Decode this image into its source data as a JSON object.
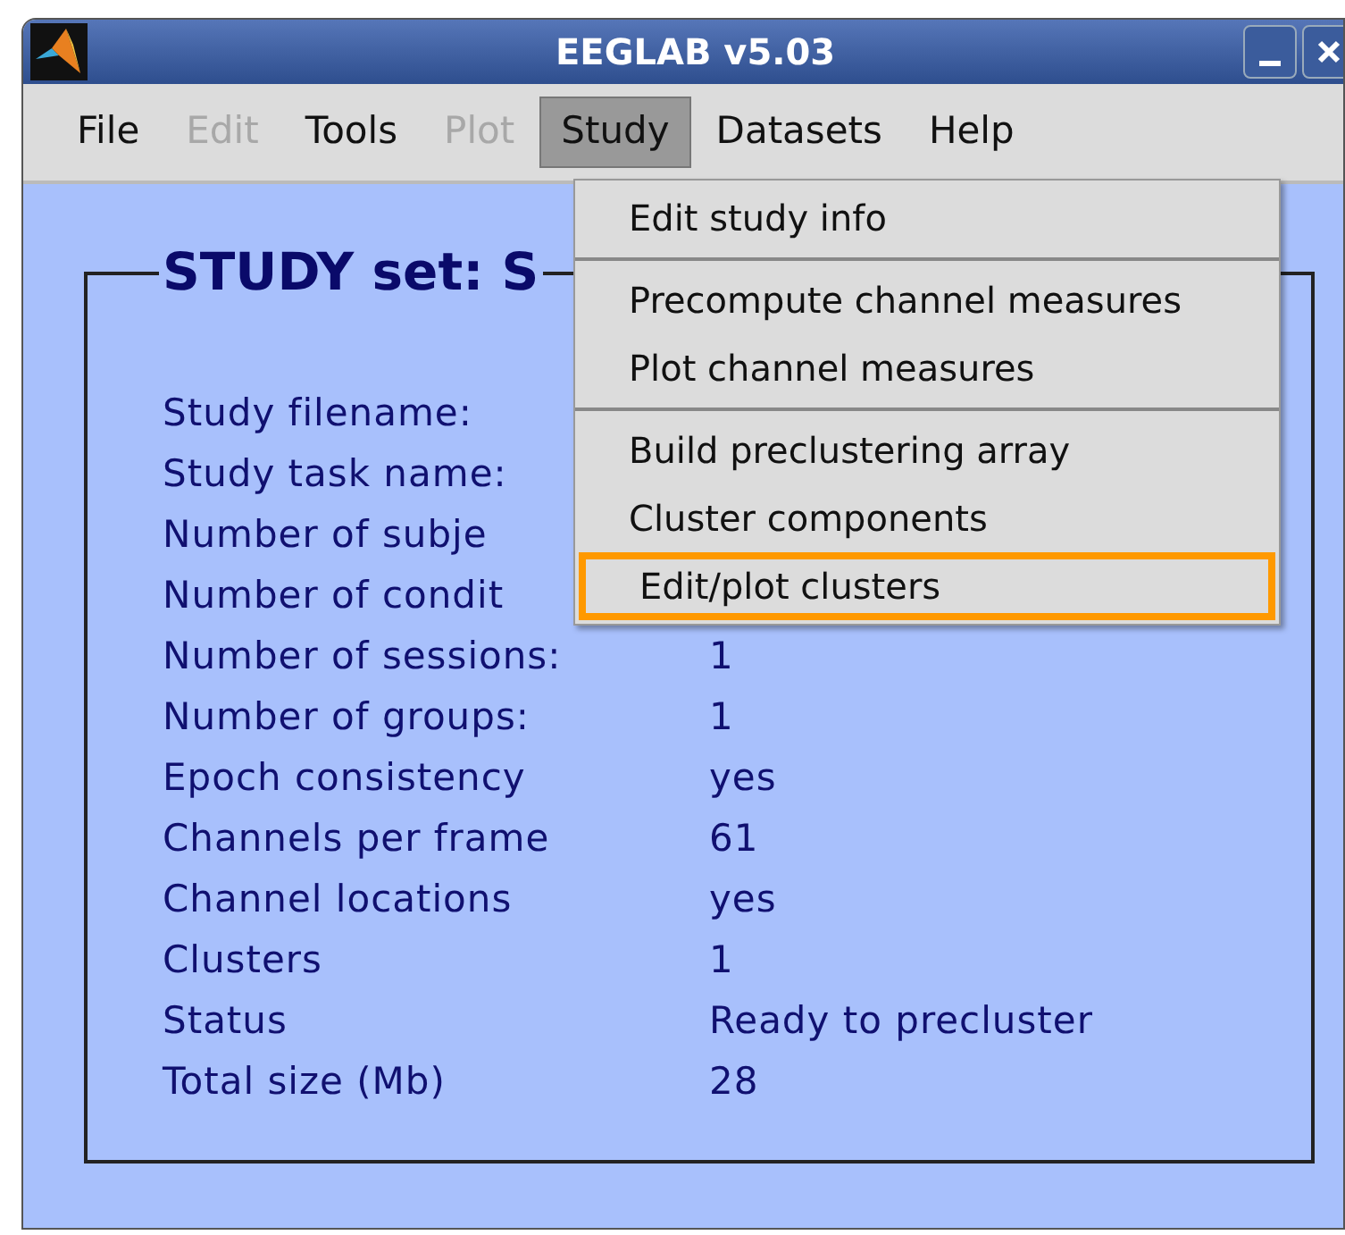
{
  "window": {
    "title": "EEGLAB v5.03"
  },
  "menubar": [
    {
      "label": "File",
      "disabled": false,
      "selected": false
    },
    {
      "label": "Edit",
      "disabled": true,
      "selected": false
    },
    {
      "label": "Tools",
      "disabled": false,
      "selected": false
    },
    {
      "label": "Plot",
      "disabled": true,
      "selected": false
    },
    {
      "label": "Study",
      "disabled": false,
      "selected": true
    },
    {
      "label": "Datasets",
      "disabled": false,
      "selected": false
    },
    {
      "label": "Help",
      "disabled": false,
      "selected": false
    }
  ],
  "study_menu": {
    "groups": [
      [
        {
          "label": "Edit study info",
          "highlighted": false
        }
      ],
      [
        {
          "label": "Precompute channel measures",
          "highlighted": false
        },
        {
          "label": "Plot channel measures",
          "highlighted": false
        }
      ],
      [
        {
          "label": "Build preclustering array",
          "highlighted": false
        },
        {
          "label": "Cluster components",
          "highlighted": false
        },
        {
          "label": "Edit/plot clusters",
          "highlighted": true
        }
      ]
    ]
  },
  "panel": {
    "title": "STUDY set: S",
    "rows": [
      {
        "label": "Study filename:"
      },
      {
        "label": "Study task name:"
      },
      {
        "label": "Number of subje"
      },
      {
        "label": "Number of condit"
      },
      {
        "label": "Number of sessions:",
        "value": "1"
      },
      {
        "label": "Number of groups:",
        "value": "1"
      },
      {
        "label": "Epoch consistency",
        "value": "yes"
      },
      {
        "label": "Channels per frame",
        "value": "61"
      },
      {
        "label": "Channel locations",
        "value": "yes"
      },
      {
        "label": "Clusters",
        "value": "1"
      },
      {
        "label": "Status",
        "value": "Ready to precluster"
      },
      {
        "label": "Total size (Mb)",
        "value": "28"
      }
    ]
  }
}
